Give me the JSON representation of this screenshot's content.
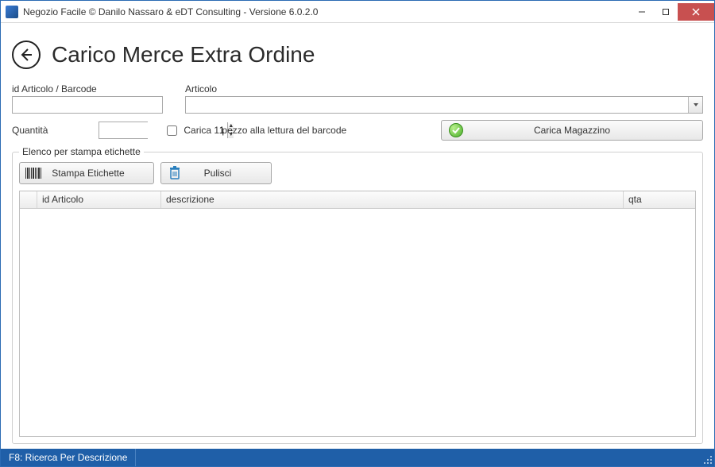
{
  "window": {
    "title": "Negozio Facile © Danilo Nassaro & eDT Consulting - Versione 6.0.2.0"
  },
  "page": {
    "title": "Carico Merce Extra Ordine"
  },
  "labels": {
    "id_barcode": "id Articolo / Barcode",
    "articolo": "Articolo",
    "quantita": "Quantità",
    "auto_load_checkbox": "Carica 1 pezzo alla lettura del barcode",
    "carica_magazzino": "Carica Magazzino",
    "groupbox_title": "Elenco per stampa etichette",
    "stampa_etichette": "Stampa Etichette",
    "pulisci": "Pulisci"
  },
  "values": {
    "id_barcode": "",
    "articolo": "",
    "quantita": "1",
    "auto_load_checked": false
  },
  "grid": {
    "columns": {
      "id": "id Articolo",
      "descrizione": "descrizione",
      "qta": "qta"
    },
    "rows": []
  },
  "status": {
    "f8": "F8: Ricerca Per Descrizione"
  }
}
